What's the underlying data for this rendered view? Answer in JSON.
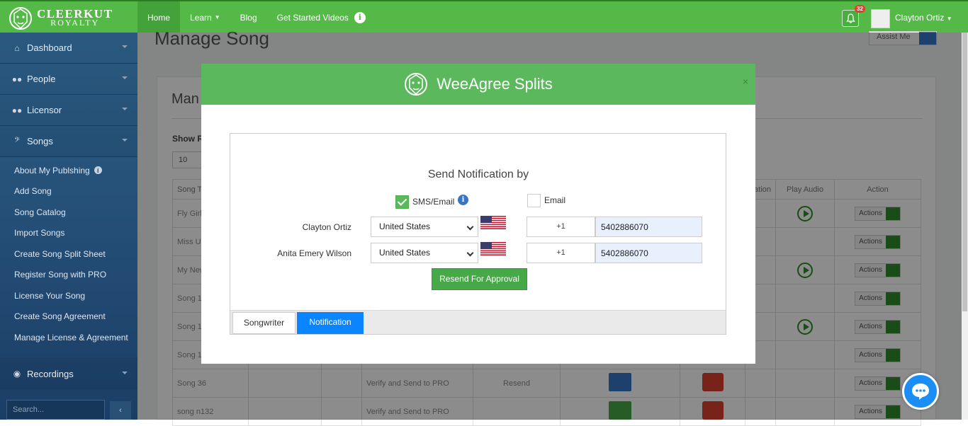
{
  "brand": {
    "line1": "CLEERKUT",
    "line2": "ROYALTY"
  },
  "nav": [
    {
      "label": "Home"
    },
    {
      "label": "Learn",
      "has_caret": true
    },
    {
      "label": "Blog"
    },
    {
      "label": "Get Started Videos"
    }
  ],
  "notifications": {
    "count": "32"
  },
  "user": {
    "name": "Clayton Ortiz"
  },
  "sidebar": {
    "items": [
      {
        "label": "Dashboard",
        "icon": "home-icon"
      },
      {
        "label": "People",
        "icon": "users-icon"
      },
      {
        "label": "Licensor",
        "icon": "users-icon"
      },
      {
        "label": "Songs",
        "icon": "music-clef-icon"
      }
    ],
    "subitems": [
      {
        "label": "About My Publshing"
      },
      {
        "label": "Add Song"
      },
      {
        "label": "Song Catalog"
      },
      {
        "label": "Import Songs"
      },
      {
        "label": "Create Song Split Sheet"
      },
      {
        "label": "Register Song with PRO"
      },
      {
        "label": "License Your Song"
      },
      {
        "label": "Create Song Agreement"
      },
      {
        "label": "Manage License & Agreement"
      }
    ],
    "recordings": "Recordings",
    "search_placeholder": "Search..."
  },
  "page": {
    "title": "Manage Song",
    "assist": "Assist Me",
    "card_title": "Man",
    "show_label": "Show R",
    "show_value": "10"
  },
  "table": {
    "headers": [
      "Song T",
      "",
      "",
      "",
      "",
      "",
      "",
      "ation",
      "Play Audio",
      "Action"
    ],
    "rows": [
      {
        "title": "Fly Girl",
        "play": true,
        "action": "Actions"
      },
      {
        "title": "Miss U",
        "play": false,
        "action": "Actions"
      },
      {
        "title": "My New",
        "play": true,
        "action": "Actions"
      },
      {
        "title": "Song 1",
        "play": false,
        "action": "Actions"
      },
      {
        "title": "Song 1",
        "play": true,
        "action": "Actions"
      },
      {
        "title": "Song 1",
        "play": false,
        "action": "Actions"
      },
      {
        "title": "Song 36",
        "link1": "Verify and Send to PRO",
        "link2": "Resend",
        "play": false,
        "action": "Actions"
      },
      {
        "title": "song n132",
        "link1": "Verify and Send to PRO",
        "link2": "",
        "play": false,
        "action": "Actions"
      }
    ]
  },
  "modal": {
    "title": "WeeAgree Splits",
    "close": "×",
    "heading": "Send Notification by",
    "sms_label": "SMS/Email",
    "sms_checked": true,
    "email_label": "Email",
    "email_checked": false,
    "people": [
      {
        "name": "Clayton Ortiz",
        "country": "United States",
        "code": "+1",
        "phone": "5402886070"
      },
      {
        "name": "Anita Emery Wilson",
        "country": "United States",
        "code": "+1",
        "phone": "5402886070"
      }
    ],
    "resend_label": "Resend For Approval",
    "tabs": [
      {
        "label": "Songwriter"
      },
      {
        "label": "Notification",
        "active": true
      }
    ]
  },
  "colors": {
    "brand_green": "#55b948",
    "sidebar_blue": "#2d5e86",
    "tab_active": "#0a84ff"
  }
}
